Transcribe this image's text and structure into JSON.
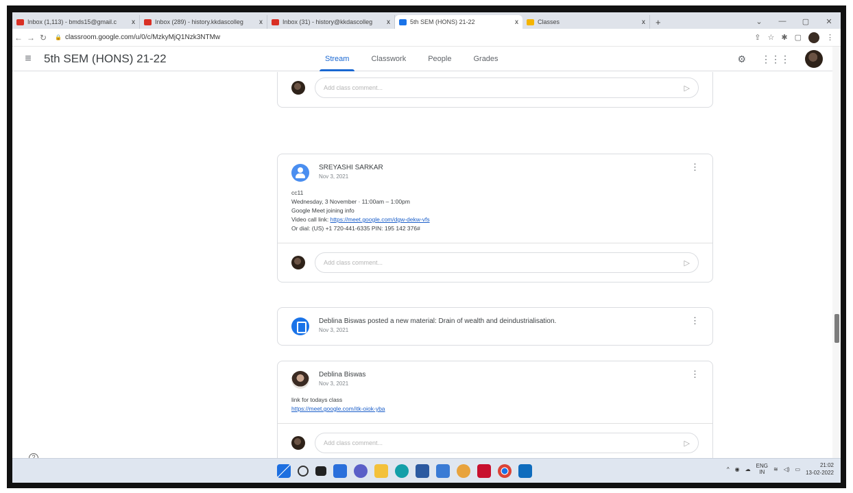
{
  "browser": {
    "tabs": [
      {
        "title": "Inbox (1,113) - bmds15@gmail.c",
        "favicon_color": "#d93025"
      },
      {
        "title": "Inbox (289) - history.kkdascolleg",
        "favicon_color": "#d93025"
      },
      {
        "title": "Inbox (31) - history@kkdascolleg",
        "favicon_color": "#d93025"
      },
      {
        "title": "5th SEM (HONS) 21-22",
        "favicon_color": "#1a73e8",
        "active": true
      },
      {
        "title": "Classes",
        "favicon_color": "#f4b400"
      }
    ],
    "tab_close": "x",
    "new_tab": "+",
    "url": "classroom.google.com/u/0/c/MzkyMjQ1Nzk3NTMw"
  },
  "classroom": {
    "course_title": "5th SEM (HONS) 21-22",
    "tabs": [
      "Stream",
      "Classwork",
      "People",
      "Grades"
    ],
    "selected_tab": "Stream"
  },
  "comment_placeholder": "Add class comment...",
  "posts": [
    {
      "author": "SREYASHI SARKAR",
      "date": "Nov 3, 2021",
      "lines": [
        "cc11",
        "Wednesday, 3 November · 11:00am – 1:00pm",
        "Google Meet joining info"
      ],
      "link_prefix": "Video call link: ",
      "link": "https://meet.google.com/dgw-dekw-vfs",
      "dial": "Or dial: (US) +1 720-441-6335 PIN: 195 142 376#"
    },
    {
      "author_line": "Deblina Biswas posted a new material: Drain of wealth and deindustrialisation.",
      "date": "Nov 3, 2021"
    },
    {
      "author": "Deblina Biswas",
      "date": "Nov 3, 2021",
      "text": "link for todays class",
      "link": "https://meet.google.com/itk-oiok-yba"
    }
  ],
  "taskbar": {
    "lang": "ENG",
    "region": "IN",
    "time": "21:02",
    "date": "13-02-2022"
  },
  "help_icon": "?"
}
